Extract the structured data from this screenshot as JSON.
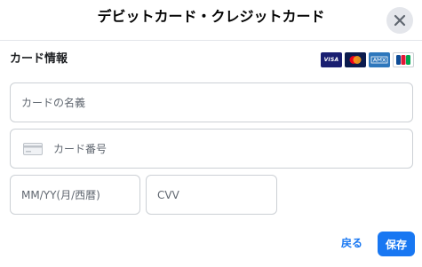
{
  "dialog": {
    "title": "デビットカード・クレジットカード",
    "close_icon": "close-icon"
  },
  "section": {
    "label": "カード情報",
    "brands": [
      {
        "name": "visa-logo",
        "text": "VISA"
      },
      {
        "name": "mastercard-logo"
      },
      {
        "name": "amex-logo"
      },
      {
        "name": "jcb-logo"
      }
    ]
  },
  "form": {
    "card_name": {
      "placeholder": "カードの名義",
      "value": ""
    },
    "card_number": {
      "placeholder": "カード番号",
      "value": "",
      "icon": "credit-card-icon"
    },
    "expiry": {
      "placeholder": "MM/YY(月/西暦)",
      "value": ""
    },
    "cvv": {
      "placeholder": "CVV",
      "value": ""
    }
  },
  "actions": {
    "back_label": "戻る",
    "save_label": "保存"
  },
  "colors": {
    "accent": "#1877f2",
    "border": "#ccd0d5",
    "close_bg": "#e4e6eb"
  }
}
